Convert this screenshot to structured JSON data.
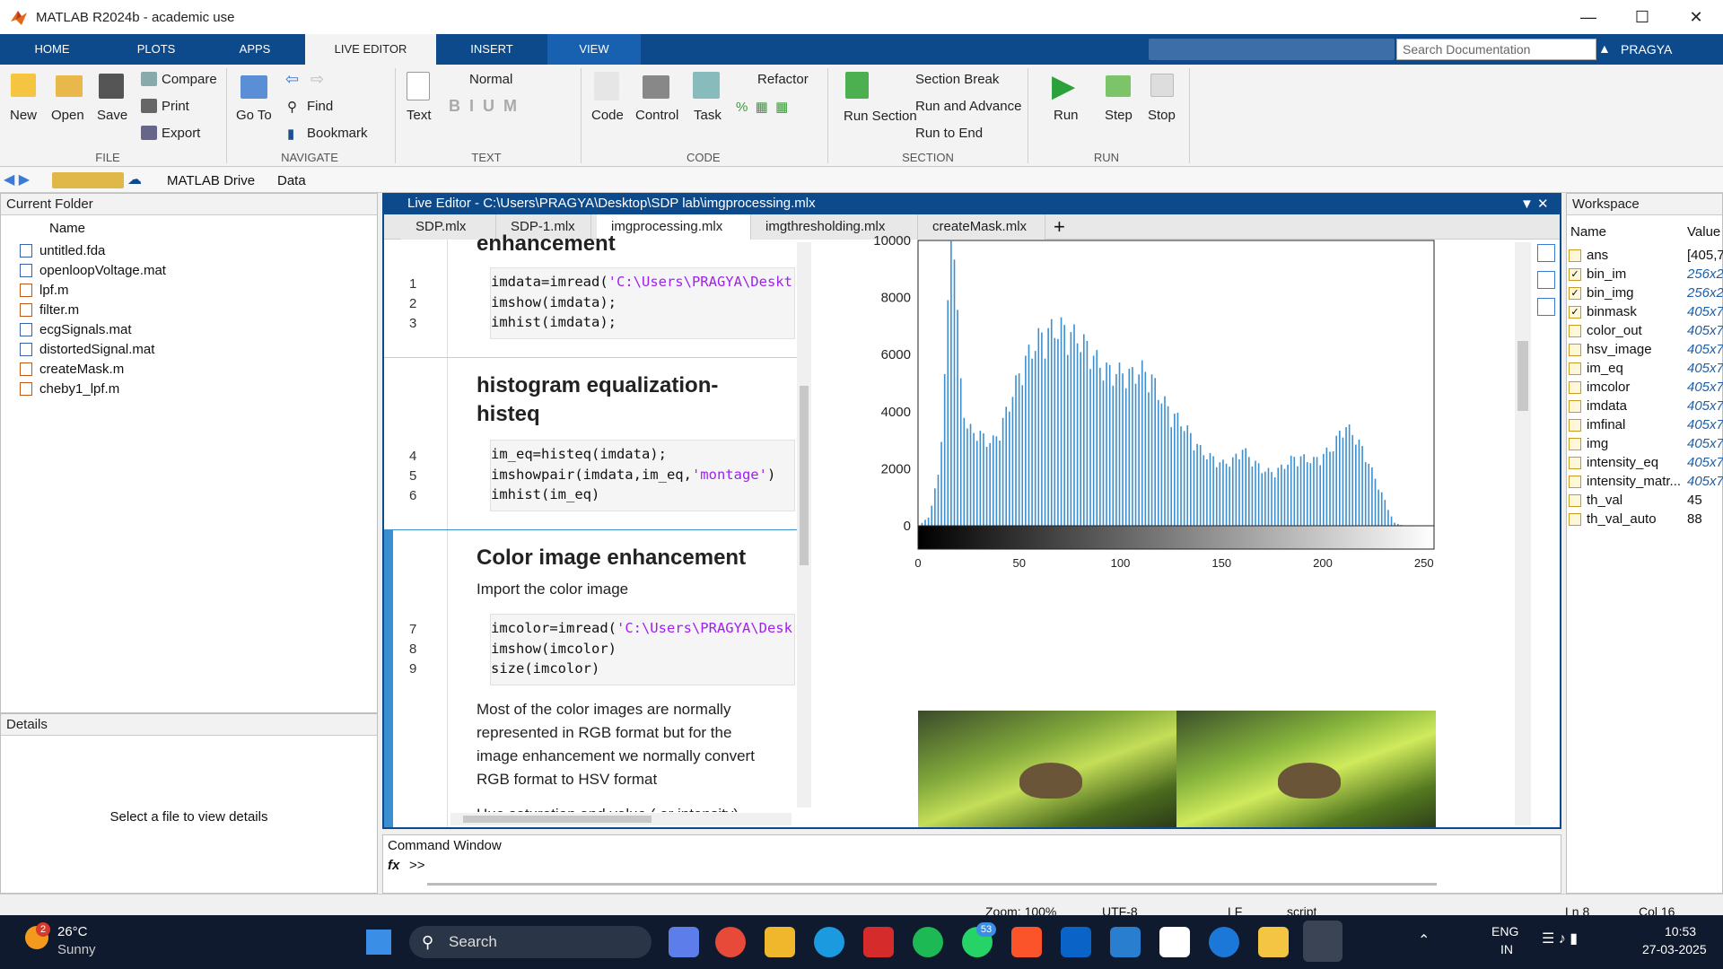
{
  "window": {
    "title": "MATLAB R2024b - academic use"
  },
  "ribbon_tabs": [
    "HOME",
    "PLOTS",
    "APPS",
    "LIVE EDITOR",
    "INSERT",
    "VIEW"
  ],
  "search_placeholder": "Search Documentation",
  "user": "PRAGYA",
  "ribbon": {
    "file": {
      "new": "New",
      "open": "Open",
      "save": "Save",
      "compare": "Compare",
      "print": "Print",
      "export": "Export",
      "group": "FILE"
    },
    "navigate": {
      "goto": "Go To",
      "find": "Find",
      "bookmark": "Bookmark",
      "group": "NAVIGATE"
    },
    "text": {
      "style": "Normal",
      "text": "Text",
      "group": "TEXT"
    },
    "code": {
      "code": "Code",
      "control": "Control",
      "task": "Task",
      "refactor": "Refactor",
      "group": "CODE"
    },
    "section": {
      "run_section": "Run Section",
      "section_break": "Section Break",
      "run_advance": "Run and Advance",
      "run_end": "Run to End",
      "group": "SECTION"
    },
    "run": {
      "run": "Run",
      "step": "Step",
      "stop": "Stop",
      "group": "RUN"
    }
  },
  "address": [
    "MATLAB Drive",
    "Data"
  ],
  "current_folder": {
    "title": "Current Folder",
    "col_name": "Name",
    "files": [
      "untitled.fda",
      "openloopVoltage.mat",
      "lpf.m",
      "filter.m",
      "ecgSignals.mat",
      "distortedSignal.mat",
      "createMask.m",
      "cheby1_lpf.m"
    ]
  },
  "details": {
    "title": "Details",
    "message": "Select a file to view details"
  },
  "editor": {
    "title": "Live Editor - C:\\Users\\PRAGYA\\Desktop\\SDP lab\\imgprocessing.mlx",
    "tabs": [
      "SDP.mlx",
      "SDP-1.mlx",
      "imgprocessing.mlx",
      "imgthresholding.mlx",
      "createMask.mlx"
    ],
    "h0": "enhancement",
    "lines1": [
      "imdata=imread(",
      "'C:\\Users\\PRAGYA\\Deskt",
      "imshow(imdata);",
      "imhist(imdata);"
    ],
    "h1a": "histogram equalization-",
    "h1b": "histeq",
    "lines2a": "im_eq=histeq(imdata);",
    "lines2b": "imshowpair(imdata,im_eq,",
    "lines2b_str": "'montage'",
    ")": ")",
    "lines2c": "imhist(im_eq)",
    "h2": "Color image enhancement",
    "p1": "Import the color image",
    "lines3a": "imcolor=imread(",
    "lines3a_str": "'C:\\Users\\PRAGYA\\Desk",
    "lines3b": "imshow(imcolor)",
    "lines3c": "size(imcolor)",
    "para": [
      "Most of the color images are normally",
      "represented in RGB format but for the",
      "image enhancement we normally convert",
      "RGB format to HSV format"
    ],
    "para_cut": "Hue saturation and value ( or intensity)",
    "line_numbers": [
      "1",
      "2",
      "3",
      "4",
      "5",
      "6",
      "7",
      "8",
      "9"
    ]
  },
  "workspace": {
    "title": "Workspace",
    "col_name": "Name",
    "col_value": "Value",
    "vars": [
      [
        "ans",
        "[405,7"
      ],
      [
        "bin_im",
        "256x2"
      ],
      [
        "bin_img",
        "256x2"
      ],
      [
        "binmask",
        "405x7"
      ],
      [
        "color_out",
        "405x7"
      ],
      [
        "hsv_image",
        "405x7"
      ],
      [
        "im_eq",
        "405x7"
      ],
      [
        "imcolor",
        "405x7"
      ],
      [
        "imdata",
        "405x7"
      ],
      [
        "imfinal",
        "405x7"
      ],
      [
        "img",
        "405x7"
      ],
      [
        "intensity_eq",
        "405x7"
      ],
      [
        "intensity_matr...",
        "405x7"
      ],
      [
        "th_val",
        "45"
      ],
      [
        "th_val_auto",
        "88"
      ]
    ]
  },
  "command_window": {
    "title": "Command Window",
    "prompt": ">>"
  },
  "status": {
    "zoom": "Zoom: 100%",
    "encoding": "UTF-8",
    "eol": "LF",
    "type": "script",
    "ln": "Ln  8",
    "col": "Col  16"
  },
  "taskbar": {
    "temp": "26°C",
    "weather": "Sunny",
    "search": "Search",
    "lang1": "ENG",
    "lang2": "IN",
    "time": "10:53",
    "date": "27-03-2025",
    "badge_whatsapp": "53",
    "badge_weather": "2"
  },
  "chart_data": {
    "type": "bar",
    "title": "",
    "xlabel": "",
    "ylabel": "",
    "xlim": [
      0,
      255
    ],
    "ylim": [
      0,
      10000
    ],
    "yticks": [
      "0",
      "2000",
      "4000",
      "6000",
      "8000",
      "10000"
    ],
    "xticks": [
      "0",
      "50",
      "100",
      "150",
      "200",
      "250"
    ],
    "x": [
      0,
      5,
      10,
      14,
      16,
      18,
      20,
      24,
      30,
      36,
      40,
      45,
      50,
      55,
      60,
      65,
      70,
      75,
      80,
      85,
      90,
      95,
      100,
      105,
      110,
      115,
      120,
      125,
      130,
      135,
      140,
      145,
      150,
      155,
      160,
      165,
      170,
      175,
      180,
      185,
      190,
      195,
      200,
      205,
      210,
      215,
      220,
      225,
      230,
      235,
      240
    ],
    "values": [
      0,
      300,
      1800,
      6500,
      10000,
      9600,
      5200,
      3300,
      3100,
      2800,
      3200,
      4200,
      5200,
      5900,
      6400,
      6600,
      6700,
      6500,
      6300,
      5900,
      5400,
      5200,
      5200,
      5100,
      5300,
      5000,
      4300,
      3800,
      3500,
      3000,
      2500,
      2300,
      2100,
      2200,
      2600,
      2200,
      1900,
      1800,
      2000,
      2300,
      2300,
      2200,
      2400,
      2700,
      3400,
      3100,
      2500,
      1700,
      900,
      100,
      0
    ],
    "colors": {
      "bar": "#3b8fd0"
    }
  }
}
